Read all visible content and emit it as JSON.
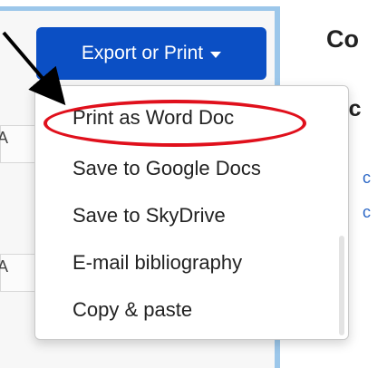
{
  "export_button": {
    "label": "Export or Print"
  },
  "dropdown": {
    "items": [
      {
        "label": "Print as Word Doc"
      },
      {
        "label": "Save to Google Docs"
      },
      {
        "label": "Save to SkyDrive"
      },
      {
        "label": "E-mail bibliography"
      },
      {
        "label": "Copy & paste"
      }
    ]
  },
  "background": {
    "partial_title": "Co",
    "partial_subtitle": "Sc",
    "partial_link_1": "c",
    "partial_link_2": "c",
    "left_hint_1": "A",
    "left_hint_2": "A"
  },
  "colors": {
    "button": "#0b4fc4",
    "highlight": "#e0101c",
    "panel_border": "#9cc7ea",
    "link": "#2b67c6"
  },
  "icons": {
    "arrow": "callout-arrow-icon",
    "caret": "caret-down-icon"
  }
}
